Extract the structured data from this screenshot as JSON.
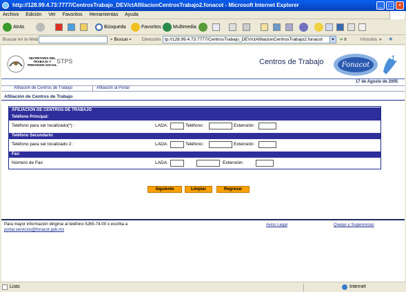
{
  "window": {
    "title": "http://128.99.4.73:7777/CentrosTrabajo_DEV/ctAfiliacionCentrosTrabajo2.fonacot - Microsoft Internet Explorer"
  },
  "menu": [
    "Archivo",
    "Edición",
    "Ver",
    "Favoritos",
    "Herramientas",
    "Ayuda"
  ],
  "toolbar": {
    "back": "Atrás",
    "search": "Búsqueda",
    "favorites": "Favoritos",
    "multimedia": "Multimedia"
  },
  "linkbar": {
    "search_placeholder": "Buscar en la Web",
    "search_button": "Buscar",
    "address_label": "Dirección",
    "address_value": "tp://128.99.4.73:7777/CentrosTrabajo_DEV/ctAfiliacionCentrosTrabajo2.fonacot",
    "go": "Ir",
    "links": "Vínculos"
  },
  "header": {
    "logo_line1": "SECRETARIA DEL",
    "logo_line2": "TRABAJO Y",
    "logo_line3": "PREVISION SOCIAL",
    "logo_abbr": "STPS",
    "page_title": "Centros de Trabajo",
    "fonacot": "Fonacot",
    "date": "17 de Agosto de 2005"
  },
  "nav": {
    "tab1": "Afiliación de Centros de Trabajo",
    "tab2": "Afiliación al Portal"
  },
  "section_title": "Afiliación de Centros de Trabajo",
  "form": {
    "heading": "AFILIACION DE CENTROS DE TRABAJO",
    "principal_heading": "Teléfono Principal:",
    "principal_label": "Teléfono para ser localizado(*) :",
    "secundario_heading": "Teléfono Secundario:",
    "secundario_label": "Teléfono para ser localizado 2:",
    "fax_heading": "Fax:",
    "fax_label": "Número de Fax:",
    "lada": "LADA:",
    "telefono": "Teléfono:",
    "extension": "Extensión:",
    "fax_extension": "Extensión:"
  },
  "buttons": {
    "next": "Siguiente",
    "clear": "Limpiar",
    "back": "Regresar"
  },
  "footer": {
    "info": "Para mayor información dirigirse al teléfono 5265-74-00 o escriba a",
    "email": "portal.servicios@fonacot.gob.mx",
    "legal": "Aviso Legal",
    "complaints": "Quejas y Sugerencias"
  },
  "status": {
    "text": "Listo",
    "zone": "Internet"
  }
}
